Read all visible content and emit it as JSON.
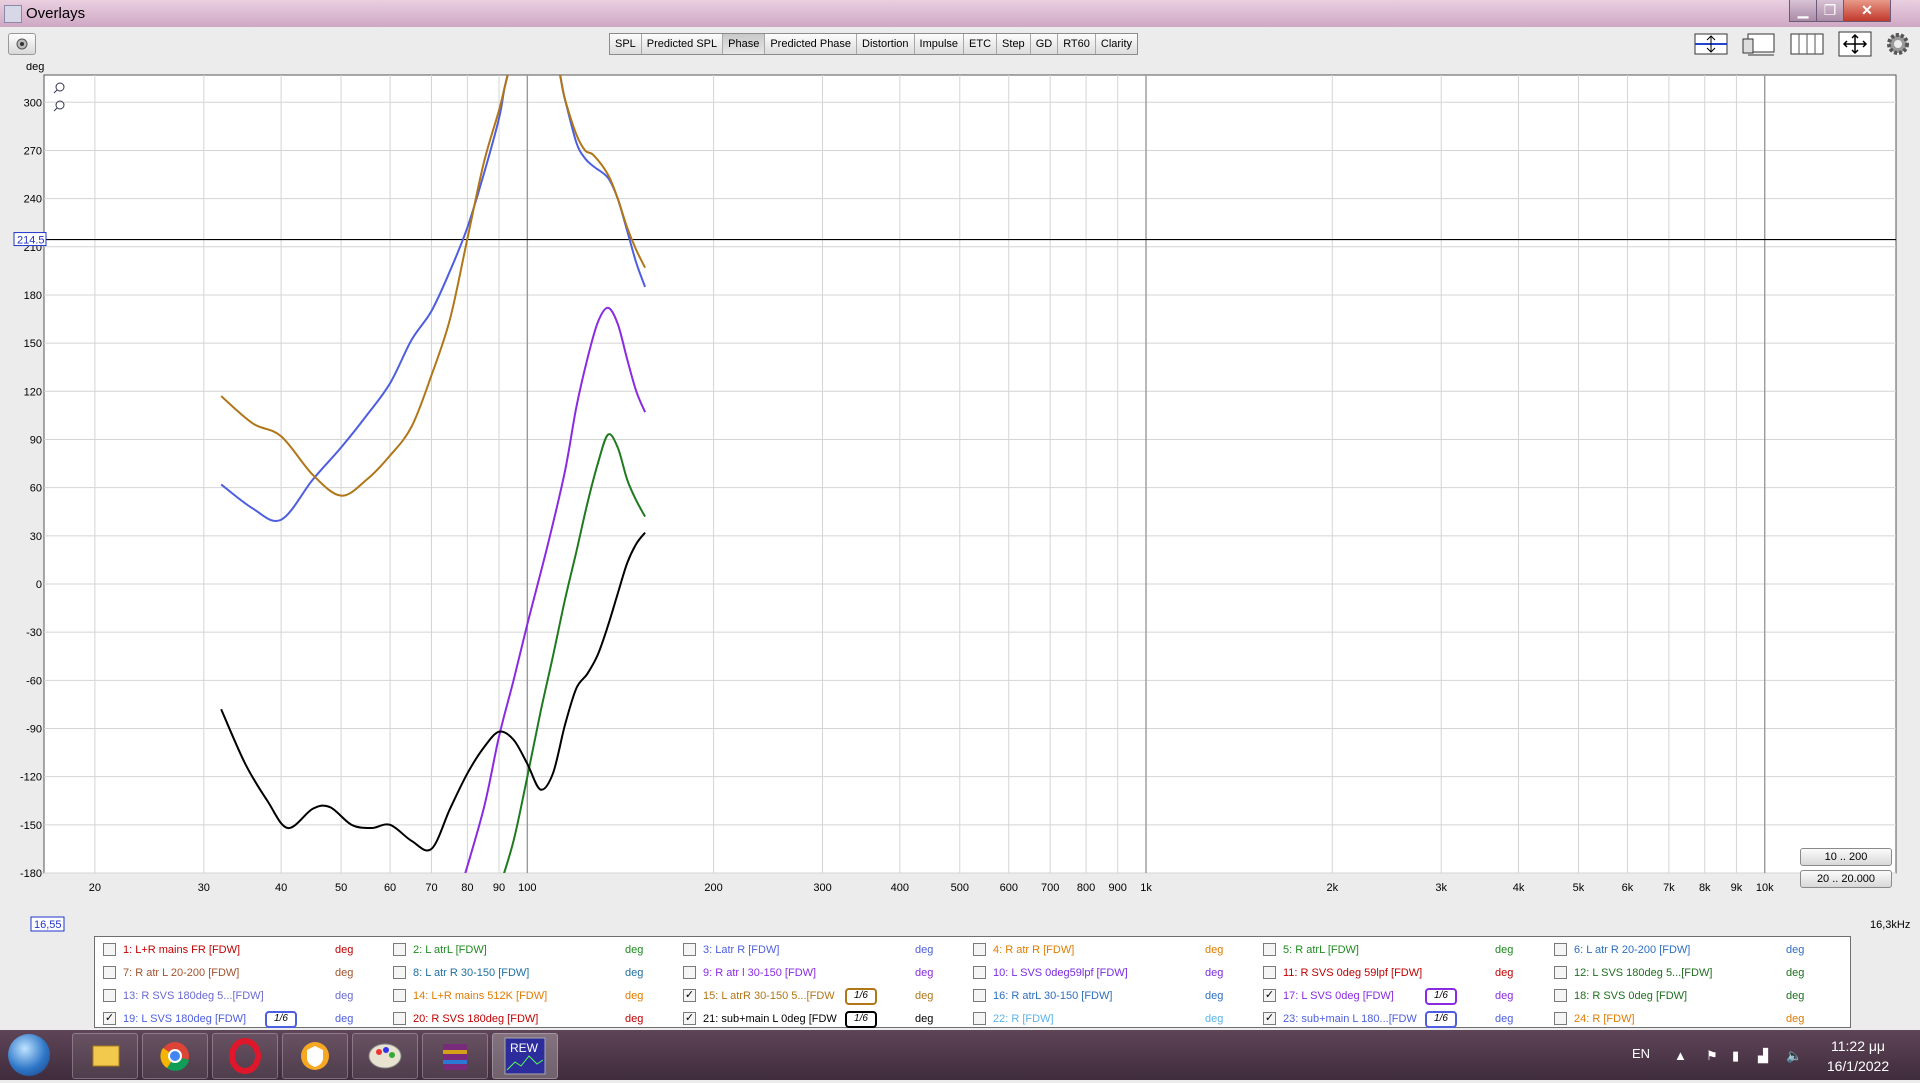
{
  "window": {
    "title": "Overlays",
    "controls": {
      "minimize": "▁",
      "maximize": "❐",
      "close": "✕"
    }
  },
  "toolbar": {
    "tabs": [
      {
        "label": "SPL",
        "active": false
      },
      {
        "label": "Predicted SPL",
        "active": false
      },
      {
        "label": "Phase",
        "active": true
      },
      {
        "label": "Predicted Phase",
        "active": false
      },
      {
        "label": "Distortion",
        "active": false
      },
      {
        "label": "Impulse",
        "active": false
      },
      {
        "label": "ETC",
        "active": false
      },
      {
        "label": "Step",
        "active": false
      },
      {
        "label": "GD",
        "active": false
      },
      {
        "label": "RT60",
        "active": false
      },
      {
        "label": "Clarity",
        "active": false
      }
    ],
    "right_icons": [
      "limits-icon",
      "overlay-view-icon",
      "grid-view-icon",
      "move-icon",
      "gear-icon"
    ]
  },
  "graph": {
    "y_unit": "deg",
    "cursor_value": "214.5",
    "x_start_value": "16,55",
    "x_end_label": "16,3kHz",
    "range_buttons": [
      "10 .. 200",
      "20 .. 20.000"
    ],
    "colors": {
      "blue": "#4d5ee0",
      "gold": "#b07618",
      "purple": "#8a2be2",
      "green": "#1f7a1f",
      "black": "#000000",
      "cursor": "#0000cc"
    }
  },
  "chart_data": {
    "type": "line",
    "title": "",
    "xlabel": "",
    "ylabel": "deg",
    "x_scale": "log",
    "xlim": [
      16.55,
      16300
    ],
    "ylim": [
      -180,
      317
    ],
    "grid": true,
    "x_ticks": [
      "20",
      "30",
      "40",
      "50",
      "60",
      "70",
      "80",
      "90",
      "100",
      "200",
      "300",
      "400",
      "500",
      "600",
      "700",
      "800",
      "900",
      "1k",
      "2k",
      "3k",
      "4k",
      "5k",
      "6k",
      "7k",
      "8k",
      "9k",
      "10k"
    ],
    "y_ticks": [
      "300",
      "270",
      "240",
      "210",
      "180",
      "150",
      "120",
      "90",
      "60",
      "30",
      "0",
      "-30",
      "-60",
      "-90",
      "-120",
      "-150",
      "-180"
    ],
    "cursor_y": 214.5,
    "series": [
      {
        "name": "19: L SVS 180deg [FDW]",
        "color": "#4d5ee0",
        "x": [
          32,
          36,
          40,
          45,
          50,
          55,
          60,
          65,
          70,
          75,
          80,
          85,
          90,
          92,
          95,
          98,
          110,
          115,
          120,
          124,
          128,
          135,
          140,
          145,
          150,
          155
        ],
        "y": [
          62,
          47,
          40,
          65,
          85,
          105,
          125,
          152,
          170,
          195,
          222,
          255,
          290,
          310,
          330,
          340,
          330,
          302,
          275,
          265,
          260,
          253,
          240,
          220,
          200,
          185
        ]
      },
      {
        "name": "15: L atrR 30-150 5...[FDW]",
        "color": "#b07618",
        "x": [
          32,
          36,
          40,
          45,
          50,
          55,
          60,
          65,
          70,
          75,
          80,
          85,
          90,
          92,
          95,
          98,
          110,
          115,
          120,
          124,
          128,
          135,
          140,
          145,
          150,
          155
        ],
        "y": [
          117,
          100,
          92,
          68,
          55,
          65,
          80,
          98,
          130,
          165,
          215,
          262,
          295,
          310,
          330,
          340,
          330,
          302,
          280,
          270,
          267,
          255,
          240,
          222,
          208,
          197
        ]
      },
      {
        "name": "17: L SVS 0deg [FDW]",
        "color": "#8a2be2",
        "x": [
          78,
          85,
          90,
          95,
          100,
          108,
          115,
          120,
          125,
          130,
          135,
          140,
          145,
          150,
          155
        ],
        "y": [
          -190,
          -140,
          -95,
          -60,
          -25,
          25,
          70,
          110,
          140,
          163,
          172,
          162,
          140,
          120,
          107
        ]
      },
      {
        "name": "23: sub+main L 180...[FDW]",
        "color": "#1f7a1f",
        "x": [
          90,
          95,
          100,
          105,
          110,
          115,
          120,
          125,
          130,
          135,
          140,
          145,
          150,
          155
        ],
        "y": [
          -190,
          -160,
          -120,
          -80,
          -45,
          -10,
          20,
          50,
          75,
          93,
          85,
          65,
          52,
          42
        ]
      },
      {
        "name": "21: sub+main L 0deg [FDW]",
        "color": "#000000",
        "x": [
          32,
          35,
          38,
          41,
          45,
          48,
          52,
          56,
          60,
          65,
          70,
          75,
          80,
          85,
          90,
          95,
          100,
          105,
          110,
          115,
          120,
          125,
          130,
          135,
          140,
          145,
          150,
          155
        ],
        "y": [
          -78,
          -112,
          -135,
          -152,
          -140,
          -139,
          -150,
          -152,
          -150,
          -160,
          -165,
          -140,
          -118,
          -102,
          -92,
          -97,
          -112,
          -128,
          -118,
          -88,
          -65,
          -56,
          -44,
          -26,
          -6,
          13,
          25,
          32
        ]
      }
    ]
  },
  "legend": {
    "unit": "deg",
    "smoothing_label": "1/6",
    "items": [
      {
        "label": "1: L+R mains FR [FDW]",
        "checked": false,
        "color": "#c00000",
        "smoothing": false
      },
      {
        "label": "2: L atrL [FDW]",
        "checked": false,
        "color": "#1f8a1f",
        "smoothing": false
      },
      {
        "label": "3: Latr R [FDW]",
        "checked": false,
        "color": "#4d5ee0",
        "smoothing": false
      },
      {
        "label": "4: R atr R [FDW]",
        "checked": false,
        "color": "#e07b00",
        "smoothing": false
      },
      {
        "label": "5: R atrL [FDW]",
        "checked": false,
        "color": "#1f8a1f",
        "smoothing": false
      },
      {
        "label": "6: L atr R 20-200 [FDW]",
        "checked": false,
        "color": "#2d6fc0",
        "smoothing": false
      },
      {
        "label": "7: R atr L 20-200 [FDW]",
        "checked": false,
        "color": "#a0522d",
        "smoothing": false
      },
      {
        "label": "8: L atr R 30-150 [FDW]",
        "checked": false,
        "color": "#1f6fa0",
        "smoothing": false
      },
      {
        "label": "9: R atr l 30-150 [FDW]",
        "checked": false,
        "color": "#8a2be2",
        "smoothing": false
      },
      {
        "label": "10: L SVS 0deg59lpf [FDW]",
        "checked": false,
        "color": "#7a2be2",
        "smoothing": false
      },
      {
        "label": "11: R SVS 0deg 59lpf [FDW]",
        "checked": false,
        "color": "#c00000",
        "smoothing": false
      },
      {
        "label": "12: L SVS 180deg 5...[FDW]",
        "checked": false,
        "color": "#1f6f1f",
        "smoothing": false
      },
      {
        "label": "13: R SVS 180deg 5...[FDW]",
        "checked": false,
        "color": "#6a6ad0",
        "smoothing": false
      },
      {
        "label": "14: L+R mains 512K [FDW]",
        "checked": false,
        "color": "#e07b00",
        "smoothing": false
      },
      {
        "label": "15: L atrR 30-150 5...[FDW",
        "checked": true,
        "color": "#b07618",
        "smoothing": true
      },
      {
        "label": "16: R atrL 30-150 [FDW]",
        "checked": false,
        "color": "#2d6fc0",
        "smoothing": false
      },
      {
        "label": "17: L SVS 0deg [FDW]",
        "checked": true,
        "color": "#8a2be2",
        "smoothing": true
      },
      {
        "label": "18: R SVS 0deg [FDW]",
        "checked": false,
        "color": "#1f6f1f",
        "smoothing": false
      },
      {
        "label": "19: L SVS 180deg [FDW]",
        "checked": true,
        "color": "#4d5ee0",
        "smoothing": true
      },
      {
        "label": "20: R SVS 180deg [FDW]",
        "checked": false,
        "color": "#c00000",
        "smoothing": false
      },
      {
        "label": "21: sub+main L 0deg [FDW",
        "checked": true,
        "color": "#000000",
        "smoothing": true
      },
      {
        "label": "22: R [FDW]",
        "checked": false,
        "color": "#5ab4e8",
        "smoothing": false
      },
      {
        "label": "23: sub+main L 180...[FDW",
        "checked": true,
        "color": "#4d5ee0",
        "smoothing": true
      },
      {
        "label": "24: R [FDW]",
        "checked": false,
        "color": "#e07b00",
        "smoothing": false
      }
    ]
  },
  "taskbar": {
    "apps": [
      "file-explorer",
      "chrome",
      "opera",
      "vpn-shield",
      "paint",
      "winrar",
      "rew"
    ],
    "language": "EN",
    "time": "11:22 μμ",
    "date": "16/1/2022"
  }
}
